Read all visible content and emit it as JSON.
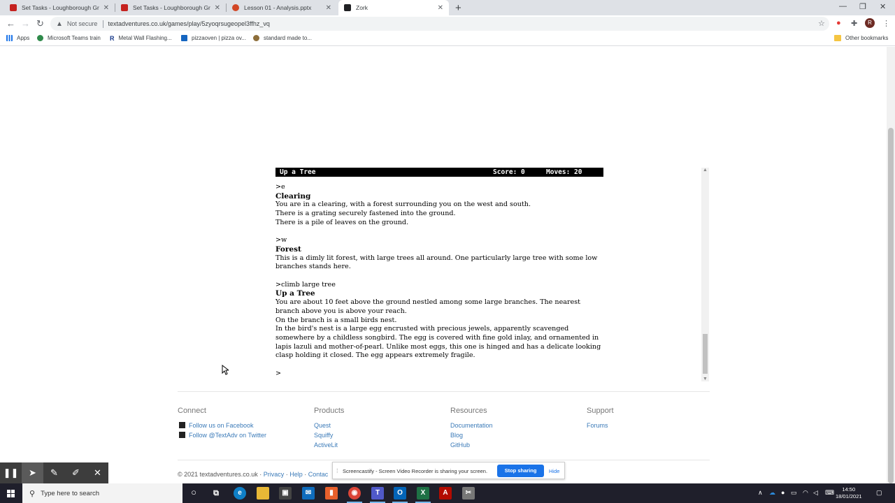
{
  "browser": {
    "tabs": [
      {
        "title": "Set Tasks - Loughborough Gramm",
        "favicon_color": "#c5221f"
      },
      {
        "title": "Set Tasks - Loughborough Gramm",
        "favicon_color": "#c5221f"
      },
      {
        "title": "Lesson 01 - Analysis.pptx",
        "favicon_color": "#d24726"
      },
      {
        "title": "Zork",
        "favicon_color": "#202124",
        "active": true
      }
    ],
    "new_tab": "+",
    "security_label": "Not secure",
    "url": "textadventures.co.uk/games/play/5zyoqrsugeopel3ffhz_vq",
    "profile_initial": "R",
    "bookmarks": [
      {
        "label": "Apps",
        "icon": "apps-grid-icon"
      },
      {
        "label": "Microsoft Teams train",
        "icon": "teams-icon"
      },
      {
        "label": "Metal Wall Flashing...",
        "icon": "r-logo-icon"
      },
      {
        "label": "pizzaoven | pizza ov...",
        "icon": "pizza-icon"
      },
      {
        "label": "standard made to...",
        "icon": "leaf-icon"
      }
    ],
    "other_bookmarks": "Other bookmarks"
  },
  "game": {
    "status_location": "Up a Tree",
    "status_score": "Score: 0",
    "status_moves": "Moves: 20",
    "transcript": [
      {
        "cmd": ">e",
        "room": "Clearing",
        "lines": [
          "You are in a clearing, with a forest surrounding you on the west and south.",
          "There is a grating securely fastened into the ground.",
          "There is a pile of leaves on the ground."
        ]
      },
      {
        "cmd": ">w",
        "room": "Forest",
        "lines": [
          "This is a dimly lit forest, with large trees all around.  One particularly large tree with some low branches stands here."
        ]
      },
      {
        "cmd": ">climb large tree",
        "room": "Up a Tree",
        "lines": [
          "You are about 10 feet above the ground nestled among some large branches.  The nearest branch above you is above your reach.",
          "On the branch is a small birds nest.",
          "In the bird's nest is a large egg encrusted with precious jewels, apparently scavenged somewhere by a childless songbird.  The egg is covered with fine gold inlay, and ornamented in lapis lazuli and mother-of-pearl.  Unlike most eggs, this one is hinged and has a delicate looking clasp holding it closed.  The egg appears extremely fragile."
        ]
      }
    ],
    "prompt": ">"
  },
  "footer": {
    "connect": {
      "heading": "Connect",
      "links": [
        "Follow us on Facebook",
        "Follow @TextAdv on Twitter"
      ]
    },
    "products": {
      "heading": "Products",
      "links": [
        "Quest",
        "Squiffy",
        "ActiveLit"
      ]
    },
    "resources": {
      "heading": "Resources",
      "links": [
        "Documentation",
        "Blog",
        "GitHub"
      ]
    },
    "support": {
      "heading": "Support",
      "links": [
        "Forums"
      ]
    },
    "copyright": "© 2021 textadventures.co.uk ·",
    "privacy": "Privacy",
    "help": "Help",
    "contact": "Contac"
  },
  "screencastify": {
    "message": "Screencastify - Screen Video Recorder is sharing your screen.",
    "stop_label": "Stop sharing",
    "hide_label": "Hide"
  },
  "taskbar": {
    "search_placeholder": "Type here to search",
    "time": "14:50",
    "date": "18/01/2021"
  }
}
